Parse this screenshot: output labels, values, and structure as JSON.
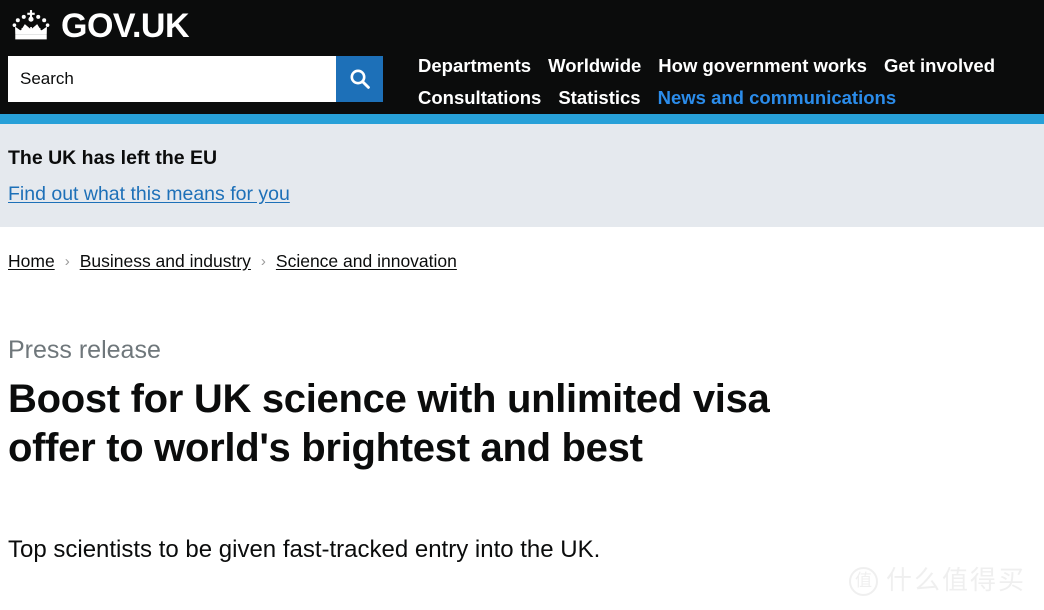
{
  "header": {
    "crown_icon": "royal-crown-icon",
    "wordmark": "GOV.UK",
    "search": {
      "placeholder": "Search",
      "value": "",
      "button_icon": "search-icon",
      "button_color": "#1d70b8"
    },
    "nav": {
      "row1": [
        {
          "label": "Departments",
          "active": false
        },
        {
          "label": "Worldwide",
          "active": false
        },
        {
          "label": "How government works",
          "active": false
        },
        {
          "label": "Get involved",
          "active": false
        }
      ],
      "row2": [
        {
          "label": "Consultations",
          "active": false
        },
        {
          "label": "Statistics",
          "active": false
        },
        {
          "label": "News and communications",
          "active": true
        }
      ]
    },
    "background_color": "#0b0c0c",
    "active_link_color": "#2b8cea"
  },
  "accent_bar": {
    "color": "#27a0d8"
  },
  "eu_banner": {
    "title": "The UK has left the EU",
    "link": "Find out what this means for you",
    "background_color": "#e5e9ee",
    "link_color": "#1d70b8"
  },
  "breadcrumb": {
    "separator": "›",
    "items": [
      {
        "label": "Home"
      },
      {
        "label": "Business and industry"
      },
      {
        "label": "Science and innovation"
      }
    ]
  },
  "main": {
    "label": "Press release",
    "label_color": "#6f777b",
    "title": "Boost for UK science with unlimited visa offer to world's brightest and best",
    "subtitle": "Top scientists to be given fast-tracked entry into the UK."
  },
  "watermark": {
    "logo_char": "值",
    "text": "什么值得买"
  }
}
